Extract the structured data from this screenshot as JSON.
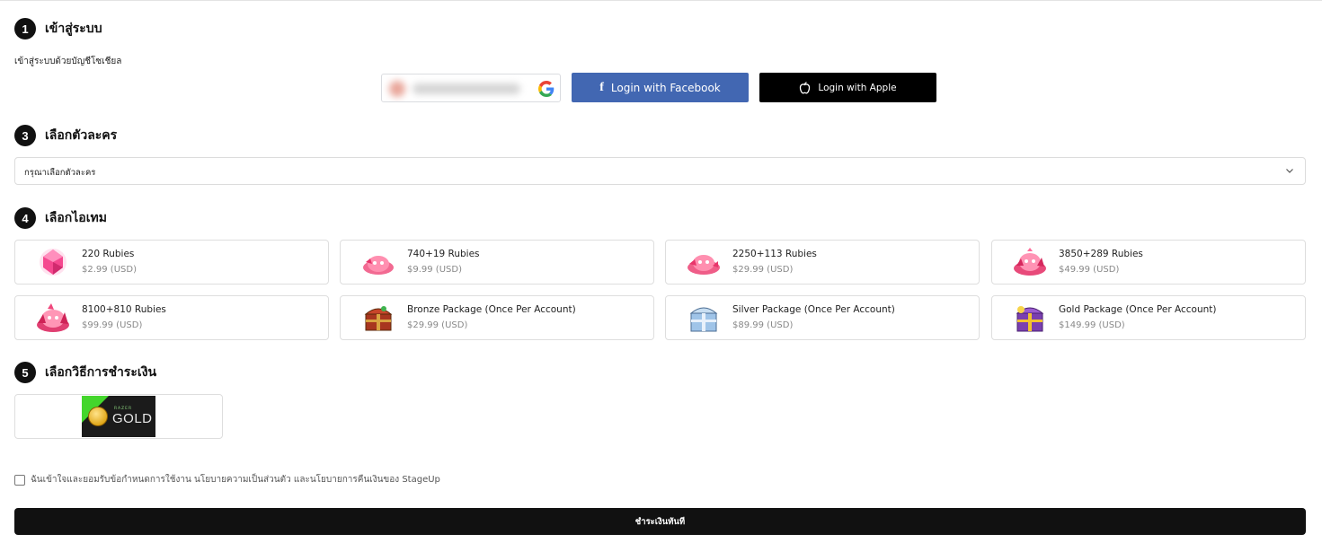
{
  "steps": {
    "login": {
      "number": "1",
      "title": "เข้าสู่ระบบ",
      "subtitle": "เข้าสู่ระบบด้วยบัญชีโซเชียล"
    },
    "character": {
      "number": "3",
      "title": "เลือกตัวละคร",
      "placeholder": "กรุณาเลือกตัวละคร"
    },
    "items": {
      "number": "4",
      "title": "เลือกไอเทม"
    },
    "payment": {
      "number": "5",
      "title": "เลือกวิธีการชำระเงิน"
    }
  },
  "login_buttons": {
    "facebook": "Login with Facebook",
    "apple": "Login with Apple"
  },
  "items": [
    {
      "name": "220 Rubies",
      "price": "$2.99 (USD)",
      "icon": "ruby-gem-icon"
    },
    {
      "name": "740+19 Rubies",
      "price": "$9.99 (USD)",
      "icon": "ruby-pile-icon"
    },
    {
      "name": "2250+113 Rubies",
      "price": "$29.99 (USD)",
      "icon": "ruby-pile-icon"
    },
    {
      "name": "3850+289 Rubies",
      "price": "$49.99 (USD)",
      "icon": "ruby-pile-icon"
    },
    {
      "name": "8100+810 Rubies",
      "price": "$99.99 (USD)",
      "icon": "ruby-pile-icon"
    },
    {
      "name": "Bronze Package (Once Per Account)",
      "price": "$29.99 (USD)",
      "icon": "bronze-chest-icon"
    },
    {
      "name": "Silver Package (Once Per Account)",
      "price": "$89.99 (USD)",
      "icon": "silver-chest-icon"
    },
    {
      "name": "Gold Package (Once Per Account)",
      "price": "$149.99 (USD)",
      "icon": "gold-chest-icon"
    }
  ],
  "payment_method": {
    "brand_small": "RAZER",
    "brand": "GOLD"
  },
  "agreement": "ฉันเข้าใจและยอมรับข้อกำหนดการใช้งาน นโยบายความเป็นส่วนตัว และนโยบายการคืนเงินของ StageUp",
  "pay_button": "ชำระเงินทันที",
  "colors": {
    "facebook": "#4267b2",
    "apple": "#000000",
    "razer_green": "#44d62c",
    "primary": "#111111"
  }
}
